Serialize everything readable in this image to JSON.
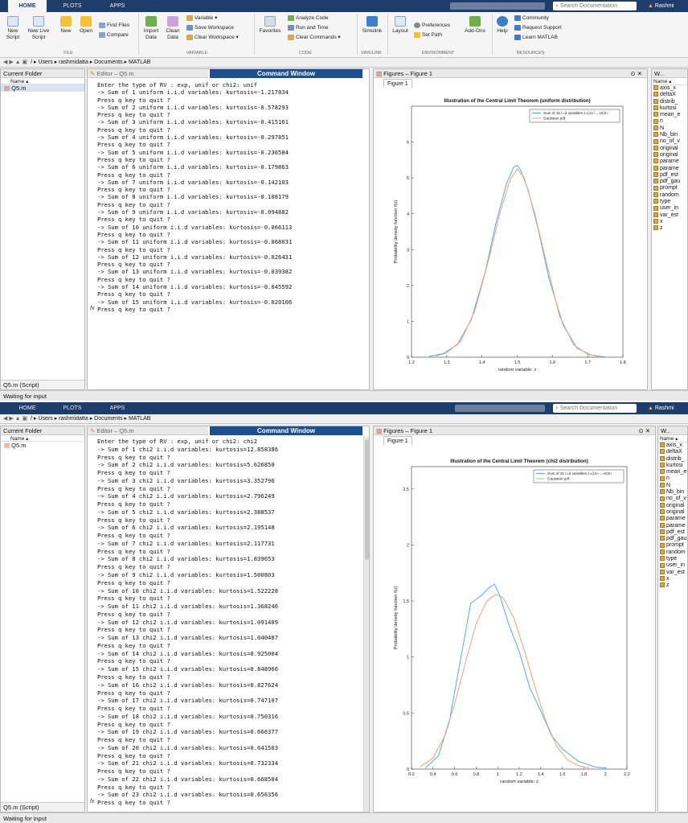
{
  "colors": {
    "tabbar": "#1f3d6b",
    "command_title": "#1f4e8c",
    "sim_line": "#5aa7e6",
    "gauss_line": "#f0a07a"
  },
  "ribbon": {
    "tabs": [
      "HOME",
      "PLOTS",
      "APPS"
    ],
    "search_placeholder": "Search Documentation",
    "user": "Rashmi",
    "file": {
      "new_script": "New Script",
      "new_live_script": "New Live Script",
      "new": "New",
      "open": "Open",
      "find_files": "Find Files",
      "compare": "Compare",
      "group": "FILE"
    },
    "variable": {
      "import_data": "Import Data",
      "clean_data": "Clean Data",
      "variable": "Variable ▾",
      "save_workspace": "Save Workspace",
      "clear_workspace": "Clear Workspace ▾",
      "group": "VARIABLE"
    },
    "code": {
      "favorites": "Favorites",
      "analyze_code": "Analyze Code",
      "run_and_time": "Run and Time",
      "clear_commands": "Clear Commands ▾",
      "group": "CODE"
    },
    "simulink": {
      "label": "Simulink",
      "group": "SIMULINK"
    },
    "environment": {
      "layout": "Layout",
      "preferences": "Preferences",
      "set_path": "Set Path",
      "add_ons": "Add-Ons",
      "group": "ENVIRONMENT"
    },
    "resources": {
      "help": "Help",
      "community": "Community",
      "request_support": "Request Support",
      "learn_matlab": "Learn MATLAB",
      "group": "RESOURCES"
    }
  },
  "address": {
    "path": "/ ▸ Users ▸ rashmidatta ▸ Documents ▸ MATLAB"
  },
  "current_folder": {
    "title": "Current Folder",
    "col_name": "Name ▴",
    "file": "Q5.m",
    "footer": "Q5.m (Script)"
  },
  "editor_tab": "Editor – Q5.m",
  "command_window_title": "Command Window",
  "status": "Waiting for input",
  "workspace": {
    "title": "W...",
    "col": "Name ▴",
    "vars": [
      "axis_x",
      "deltaX",
      "distrib_",
      "kurtosi",
      "mean_e",
      "n",
      "N",
      "Nb_bin",
      "no_of_v",
      "original",
      "original",
      "parame",
      "parame",
      "pdf_est",
      "pdf_gau",
      "prompt",
      "random",
      "type",
      "user_in",
      "var_est",
      "x",
      "z"
    ]
  },
  "figures": {
    "title": "Figures – Figure 1",
    "tab": "Figure 1"
  },
  "console_top": [
    "Enter the type of RV : exp, unif or chi2: unif",
    "-> Sum of 1 uniform i.i.d variables: kurtosis=-1.217834",
    "Press q key to quit ?",
    "-> Sum of 2 uniform i.i.d variables: kurtosis=-0.578293",
    "Press q key to quit ?",
    "-> Sum of 3 uniform i.i.d variables: kurtosis=-0.415161",
    "Press q key to quit ?",
    "-> Sum of 4 uniform i.i.d variables: kurtosis=-0.297851",
    "Press q key to quit ?",
    "-> Sum of 5 uniform i.i.d variables: kurtosis=-0.236584",
    "Press q key to quit ?",
    "-> Sum of 6 uniform i.i.d variables: kurtosis=-0.179863",
    "Press q key to quit ?",
    "-> Sum of 7 uniform i.i.d variables: kurtosis=-0.142103",
    "Press q key to quit ?",
    "-> Sum of 8 uniform i.i.d variables: kurtosis=-0.108179",
    "Press q key to quit ?",
    "-> Sum of 9 uniform i.i.d variables: kurtosis=-0.094882",
    "Press q key to quit ?",
    "-> Sum of 10 uniform i.i.d variables: kurtosis=-0.066113",
    "Press q key to quit ?",
    "-> Sum of 11 uniform i.i.d variables: kurtosis=-0.068031",
    "Press q key to quit ?",
    "-> Sum of 12 uniform i.i.d variables: kurtosis=-0.026431",
    "Press q key to quit ?",
    "-> Sum of 13 uniform i.i.d variables: kurtosis=-0.039382",
    "Press q key to quit ?",
    "-> Sum of 14 uniform i.i.d variables: kurtosis=-0.045592",
    "Press q key to quit ?",
    "-> Sum of 15 uniform i.i.d variables: kurtosis=-0.020106",
    "Press q key to quit ?"
  ],
  "console_bottom": [
    "Enter the type of RV : exp, unif or chi2: chi2",
    "-> Sum of 1 chi2 i.i.d variables: kurtosis=12.858386",
    "Press q key to quit ?",
    "-> Sum of 2 chi2 i.i.d variables: kurtosis=5.626850",
    "Press q key to quit ?",
    "-> Sum of 3 chi2 i.i.d variables: kurtosis=3.352796",
    "Press q key to quit ?",
    "-> Sum of 4 chi2 i.i.d variables: kurtosis=2.796249",
    "Press q key to quit ?",
    "-> Sum of 5 chi2 i.i.d variables: kurtosis=2.388537",
    "Press q key to quit ?",
    "-> Sum of 6 chi2 i.i.d variables: kurtosis=2.195148",
    "Press q key to quit ?",
    "-> Sum of 7 chi2 i.i.d variables: kurtosis=2.117731",
    "Press q key to quit ?",
    "-> Sum of 8 chi2 i.i.d variables: kurtosis=1.839653",
    "Press q key to quit ?",
    "-> Sum of 9 chi2 i.i.d variables: kurtosis=1.500803",
    "Press q key to quit ?",
    "-> Sum of 10 chi2 i.i.d variables: kurtosis=1.522228",
    "Press q key to quit ?",
    "-> Sum of 11 chi2 i.i.d variables: kurtosis=1.368246",
    "Press q key to quit ?",
    "-> Sum of 12 chi2 i.i.d variables: kurtosis=1.091409",
    "Press q key to quit ?",
    "-> Sum of 13 chi2 i.i.d variables: kurtosis=1.040487",
    "Press q key to quit ?",
    "-> Sum of 14 chi2 i.i.d variables: kurtosis=0.925004",
    "Press q key to quit ?",
    "-> Sum of 15 chi2 i.i.d variables: kurtosis=0.848966",
    "Press q key to quit ?",
    "-> Sum of 16 chi2 i.i.d variables: kurtosis=0.827624",
    "Press q key to quit ?",
    "-> Sum of 17 chi2 i.i.d variables: kurtosis=0.747107",
    "Press q key to quit ?",
    "-> Sum of 18 chi2 i.i.d variables: kurtosis=0.750316",
    "Press q key to quit ?",
    "-> Sum of 19 chi2 i.i.d variables: kurtosis=0.666377",
    "Press q key to quit ?",
    "-> Sum of 20 chi2 i.i.d variables: kurtosis=0.641503",
    "Press q key to quit ?",
    "-> Sum of 21 chi2 i.i.d variables: kurtosis=0.732334",
    "Press q key to quit ?",
    "-> Sum of 22 chi2 i.i.d variables: kurtosis=0.668504",
    "Press q key to quit ?",
    "-> Sum of 23 chi2 i.i.d variables: kurtosis=0.656356",
    "Press q key to quit ?"
  ],
  "chart_data": [
    {
      "type": "line",
      "title": "Illustration of the Central Limit Theorem (uniform distribution)",
      "xlabel": "random variable: z",
      "ylabel": "Probability density function f(z)",
      "xlim": [
        1.2,
        1.8
      ],
      "ylim": [
        0,
        7
      ],
      "xticks": [
        "1.2",
        "1.3",
        "1.4",
        "1.5",
        "1.6",
        "1.7",
        "1.8"
      ],
      "yticks": [
        "0",
        "1",
        "2",
        "3",
        "4",
        "5",
        "6"
      ],
      "legend_position": "top-right",
      "grid": false,
      "series": [
        {
          "name": "Sum of 15 i.i.d variables z=(x1+....xn)/n",
          "color": "#5aa7e6",
          "x": [
            1.25,
            1.29,
            1.33,
            1.37,
            1.41,
            1.44,
            1.47,
            1.49,
            1.5,
            1.51,
            1.53,
            1.56,
            1.59,
            1.63,
            1.67,
            1.71,
            1.75
          ],
          "y": [
            0.02,
            0.1,
            0.35,
            1.05,
            2.4,
            3.75,
            4.85,
            5.3,
            5.35,
            5.2,
            4.7,
            3.55,
            2.2,
            0.9,
            0.25,
            0.06,
            0.01
          ]
        },
        {
          "name": "Gaussian pdf",
          "color": "#f0a07a",
          "x": [
            1.27,
            1.3,
            1.34,
            1.38,
            1.42,
            1.45,
            1.48,
            1.5,
            1.52,
            1.55,
            1.58,
            1.62,
            1.66,
            1.7,
            1.73
          ],
          "y": [
            0.03,
            0.12,
            0.45,
            1.3,
            2.75,
            4.0,
            4.95,
            5.25,
            5.0,
            4.0,
            2.75,
            1.15,
            0.35,
            0.08,
            0.02
          ]
        }
      ]
    },
    {
      "type": "line",
      "title": "Illustration of the Central Limit Theorem (chi2 distribution)",
      "xlabel": "random variable: z",
      "ylabel": "Probability density function f(z)",
      "xlim": [
        0.2,
        2.2
      ],
      "ylim": [
        0,
        2.7
      ],
      "xticks": [
        "0.2",
        "0.4",
        "0.6",
        "0.8",
        "1",
        "1.2",
        "1.4",
        "1.6",
        "1.8",
        "2",
        "2.2"
      ],
      "yticks": [
        "0",
        "0.5",
        "1",
        "1.5",
        "2",
        "2.5"
      ],
      "legend_position": "top-right",
      "grid": false,
      "series": [
        {
          "name": "Sum of 21 i.i.d variables z=(x1+....xn)/n",
          "color": "#5aa7e6",
          "x": [
            0.33,
            0.45,
            0.55,
            0.65,
            0.75,
            0.85,
            0.92,
            0.97,
            1.02,
            1.1,
            1.2,
            1.3,
            1.4,
            1.5,
            1.6,
            1.75,
            1.9,
            2.0
          ],
          "y": [
            0.01,
            0.12,
            0.42,
            0.95,
            1.48,
            1.55,
            1.62,
            1.65,
            1.55,
            1.3,
            1.05,
            0.72,
            0.52,
            0.3,
            0.18,
            0.07,
            0.02,
            0.01
          ]
        },
        {
          "name": "Gaussian pdf",
          "color": "#f0a07a",
          "x": [
            0.28,
            0.4,
            0.5,
            0.6,
            0.7,
            0.8,
            0.9,
            0.98,
            1.05,
            1.15,
            1.25,
            1.35,
            1.45,
            1.55,
            1.65,
            1.75,
            1.85
          ],
          "y": [
            0.02,
            0.1,
            0.28,
            0.58,
            0.95,
            1.3,
            1.5,
            1.56,
            1.53,
            1.35,
            1.05,
            0.72,
            0.42,
            0.2,
            0.08,
            0.03,
            0.01
          ]
        }
      ]
    }
  ]
}
